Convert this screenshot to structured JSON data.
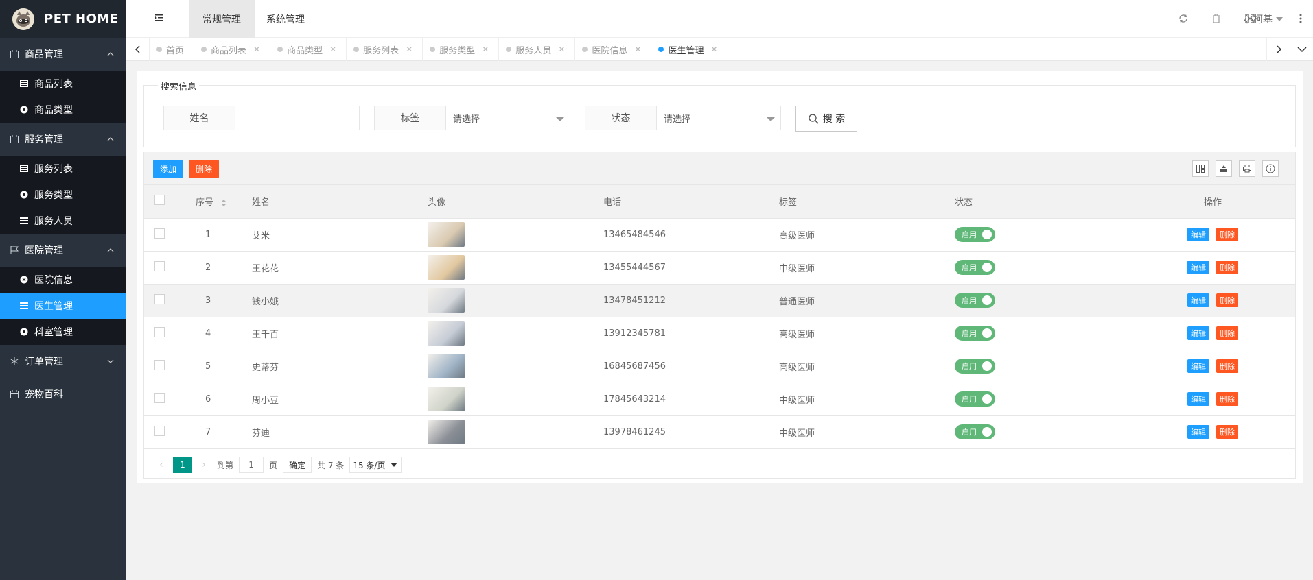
{
  "app": {
    "logo_text": "PET HOME"
  },
  "sidebar": {
    "groups": [
      {
        "title": "商品管理",
        "icon": "calendar-icon",
        "expanded": true,
        "items": [
          {
            "label": "商品列表",
            "icon": "table-icon"
          },
          {
            "label": "商品类型",
            "icon": "dashboard-icon"
          }
        ]
      },
      {
        "title": "服务管理",
        "icon": "calendar-icon",
        "expanded": true,
        "items": [
          {
            "label": "服务列表",
            "icon": "table-icon"
          },
          {
            "label": "服务类型",
            "icon": "dashboard-icon"
          },
          {
            "label": "服务人员",
            "icon": "list-icon"
          }
        ]
      },
      {
        "title": "医院管理",
        "icon": "flag-icon",
        "expanded": true,
        "items": [
          {
            "label": "医院信息",
            "icon": "circle-icon"
          },
          {
            "label": "医生管理",
            "icon": "list-icon",
            "active": true
          },
          {
            "label": "科室管理",
            "icon": "dashboard-icon"
          }
        ]
      },
      {
        "title": "订单管理",
        "icon": "snowflake-icon",
        "expanded": false,
        "items": []
      },
      {
        "title": "宠物百科",
        "icon": "calendar-icon",
        "expanded": false,
        "items": []
      }
    ]
  },
  "header": {
    "tabs": [
      {
        "label": "常规管理",
        "active": true
      },
      {
        "label": "系统管理",
        "active": false
      }
    ],
    "user": "小柯基"
  },
  "page_tabs": [
    {
      "label": "首页",
      "closable": false
    },
    {
      "label": "商品列表",
      "closable": true
    },
    {
      "label": "商品类型",
      "closable": true
    },
    {
      "label": "服务列表",
      "closable": true
    },
    {
      "label": "服务类型",
      "closable": true
    },
    {
      "label": "服务人员",
      "closable": true
    },
    {
      "label": "医院信息",
      "closable": true
    },
    {
      "label": "医生管理",
      "closable": true,
      "active": true
    }
  ],
  "search": {
    "legend": "搜索信息",
    "name_label": "姓名",
    "name_value": "",
    "tag_label": "标签",
    "tag_value": "请选择",
    "status_label": "状态",
    "status_value": "请选择",
    "button": "搜 索"
  },
  "toolbar": {
    "add": "添加",
    "delete": "删除"
  },
  "table": {
    "headers": {
      "index": "序号",
      "name": "姓名",
      "avatar": "头像",
      "phone": "电话",
      "tag": "标签",
      "status": "状态",
      "ops": "操作"
    },
    "rows": [
      {
        "index": "1",
        "name": "艾米",
        "phone": "13465484546",
        "tag": "高级医师",
        "status": "启用",
        "color": "#d9c9b0"
      },
      {
        "index": "2",
        "name": "王花花",
        "phone": "13455444567",
        "tag": "中级医师",
        "status": "启用",
        "color": "#e2c8a0"
      },
      {
        "index": "3",
        "name": "钱小娥",
        "phone": "13478451212",
        "tag": "普通医师",
        "status": "启用",
        "color": "#d5d8dc"
      },
      {
        "index": "4",
        "name": "王千百",
        "phone": "13912345781",
        "tag": "高级医师",
        "status": "启用",
        "color": "#c6ccd6"
      },
      {
        "index": "5",
        "name": "史蒂芬",
        "phone": "16845687456",
        "tag": "高级医师",
        "status": "启用",
        "color": "#9fb3c6"
      },
      {
        "index": "6",
        "name": "周小豆",
        "phone": "17845643214",
        "tag": "中级医师",
        "status": "启用",
        "color": "#cfd3c8"
      },
      {
        "index": "7",
        "name": "芬迪",
        "phone": "13978461245",
        "tag": "中级医师",
        "status": "启用",
        "color": "#8b8f96"
      }
    ],
    "edit_label": "编辑",
    "delete_label": "删除"
  },
  "pager": {
    "current": "1",
    "goto_prefix": "到第",
    "goto_value": "1",
    "goto_suffix": "页",
    "confirm": "确定",
    "total": "共 7 条",
    "limit": "15 条/页"
  },
  "colors": {
    "primary": "#1e9fff",
    "danger": "#ff5722",
    "success": "#5fb878",
    "pager_active": "#009688",
    "sidebar_bg": "#2a333d"
  }
}
